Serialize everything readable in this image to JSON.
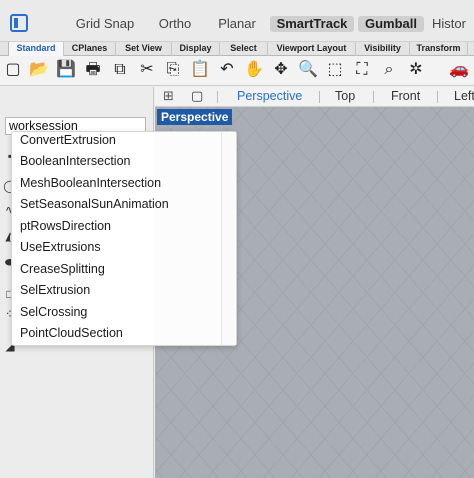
{
  "status_bar": {
    "buttons": [
      {
        "label": "Grid Snap",
        "active": false
      },
      {
        "label": "Ortho",
        "active": false
      },
      {
        "label": "Planar",
        "active": false
      },
      {
        "label": "SmartTrack",
        "active": true
      },
      {
        "label": "Gumball",
        "active": true
      },
      {
        "label": "Histor",
        "active": false
      }
    ]
  },
  "tabs": [
    {
      "label": "Standard",
      "active": true
    },
    {
      "label": "CPlanes",
      "active": false
    },
    {
      "label": "Set View",
      "active": false
    },
    {
      "label": "Display",
      "active": false
    },
    {
      "label": "Select",
      "active": false
    },
    {
      "label": "Viewport Layout",
      "active": false
    },
    {
      "label": "Visibility",
      "active": false
    },
    {
      "label": "Transform",
      "active": false
    }
  ],
  "toolbar_icons": [
    {
      "name": "new-document-icon",
      "glyph": "▢"
    },
    {
      "name": "open-folder-icon",
      "glyph": "📂"
    },
    {
      "name": "save-icon",
      "glyph": "💾"
    },
    {
      "name": "print-icon",
      "glyph": "🖶"
    },
    {
      "name": "import-icon",
      "glyph": "⧉"
    },
    {
      "name": "cut-icon",
      "glyph": "✂"
    },
    {
      "name": "copy-icon",
      "glyph": "⎘"
    },
    {
      "name": "paste-icon",
      "glyph": "📋"
    },
    {
      "name": "undo-icon",
      "glyph": "↶"
    },
    {
      "name": "pan-hand-icon",
      "glyph": "✋"
    },
    {
      "name": "rotate-view-icon",
      "glyph": "✥"
    },
    {
      "name": "zoom-icon",
      "glyph": "🔍"
    },
    {
      "name": "zoom-window-icon",
      "glyph": "⬚"
    },
    {
      "name": "zoom-extents-icon",
      "glyph": "⛶"
    },
    {
      "name": "zoom-selected-icon",
      "glyph": "⌕"
    },
    {
      "name": "select-options-icon",
      "glyph": "✲"
    },
    {
      "name": "car-icon",
      "glyph": "🚗"
    }
  ],
  "command": {
    "input_value": "worksession"
  },
  "viewport_tabs": [
    {
      "label": "Perspective",
      "active": true
    },
    {
      "label": "Top",
      "active": false
    },
    {
      "label": "Front",
      "active": false
    },
    {
      "label": "Left",
      "active": false
    }
  ],
  "viewport": {
    "label": "Perspective",
    "background_color": "#a9aeb4",
    "grid_color": "#9ea3a9"
  },
  "autocomplete": {
    "items": [
      "ConvertExtrusion",
      "BooleanIntersection",
      "MeshBooleanIntersection",
      "SetSeasonalSunAnimation",
      "ptRowsDirection",
      "UseExtrusions",
      "CreaseSplitting",
      "SelExtrusion",
      "SelCrossing",
      "PointCloudSection"
    ]
  },
  "colors": {
    "accent": "#2a6fd0",
    "viewport_label_bg": "#1f5aa8"
  }
}
